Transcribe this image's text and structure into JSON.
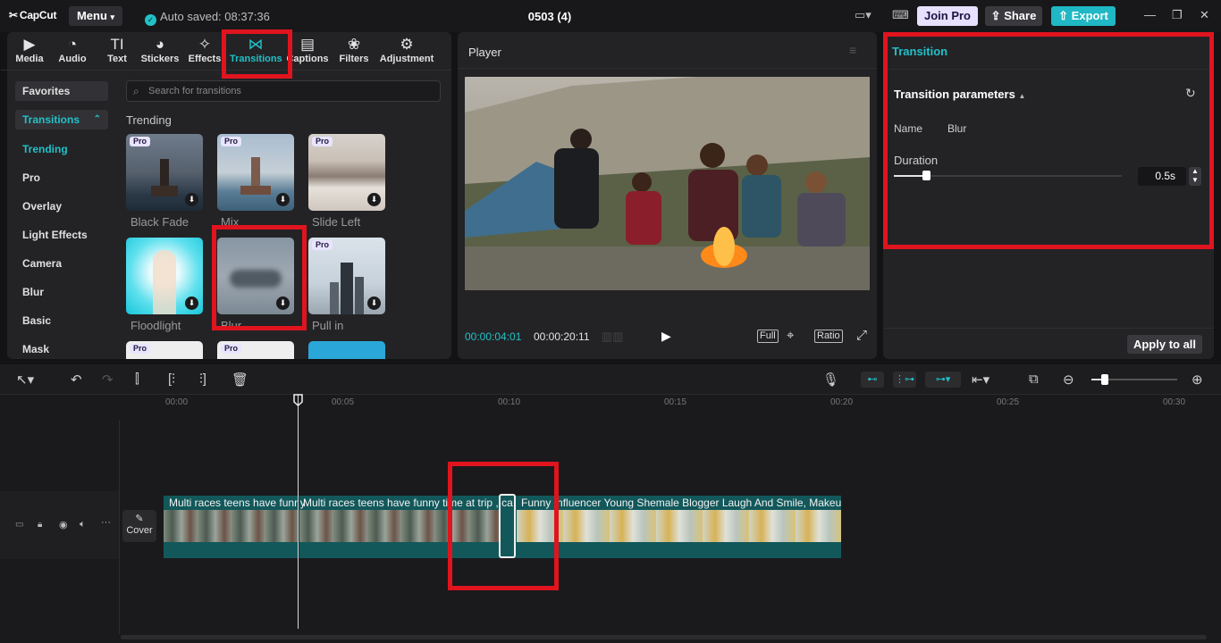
{
  "app": {
    "logo": "CapCut",
    "menu_label": "Menu",
    "autosave": "Auto saved: 08:37:36",
    "project_title": "0503 (4)",
    "join_pro": "Join Pro",
    "share": "Share",
    "export": "Export",
    "accent": "#21c1c7"
  },
  "tabs": [
    {
      "label": "Media",
      "icon": "media-icon"
    },
    {
      "label": "Audio",
      "icon": "audio-icon"
    },
    {
      "label": "Text",
      "icon": "text-icon"
    },
    {
      "label": "Stickers",
      "icon": "stickers-icon"
    },
    {
      "label": "Effects",
      "icon": "effects-icon"
    },
    {
      "label": "Transitions",
      "icon": "transitions-icon",
      "active": true
    },
    {
      "label": "Captions",
      "icon": "captions-icon"
    },
    {
      "label": "Filters",
      "icon": "filters-icon"
    },
    {
      "label": "Adjustment",
      "icon": "adjustment-icon"
    }
  ],
  "sidebar": [
    {
      "label": "Favorites"
    },
    {
      "label": "Transitions"
    },
    {
      "label": "Trending",
      "active": true
    },
    {
      "label": "Pro"
    },
    {
      "label": "Overlay"
    },
    {
      "label": "Light Effects"
    },
    {
      "label": "Camera"
    },
    {
      "label": "Blur"
    },
    {
      "label": "Basic"
    },
    {
      "label": "Mask"
    }
  ],
  "search": {
    "placeholder": "Search for transitions"
  },
  "section_title": "Trending",
  "transitions": [
    {
      "label": "Black Fade",
      "pro": "Pro"
    },
    {
      "label": "Mix",
      "pro": "Pro"
    },
    {
      "label": "Slide Left",
      "pro": "Pro"
    },
    {
      "label": "Floodlight"
    },
    {
      "label": "Blur"
    },
    {
      "label": "Pull in",
      "pro": "Pro"
    }
  ],
  "player": {
    "title": "Player",
    "current_time": "00:00:04:01",
    "total_time": "00:00:20:11",
    "full": "Full",
    "ratio": "Ratio"
  },
  "right": {
    "title": "Transition",
    "params_title": "Transition parameters",
    "name_label": "Name",
    "name_value": "Blur",
    "duration_label": "Duration",
    "duration_value": "0.5s",
    "duration_fraction": 0.14,
    "apply_all": "Apply to all"
  },
  "ruler": [
    "00:00",
    "00:05",
    "00:10",
    "00:15",
    "00:20",
    "00:25",
    "00:30"
  ],
  "clips": [
    {
      "label": "Multi races teens have funny"
    },
    {
      "label": "Multi races teens have funny time at trip , ca"
    },
    {
      "label": "Funny Influencer Young Shemale Blogger Laugh And Smile, Makeup"
    }
  ],
  "cover_label": "Cover"
}
